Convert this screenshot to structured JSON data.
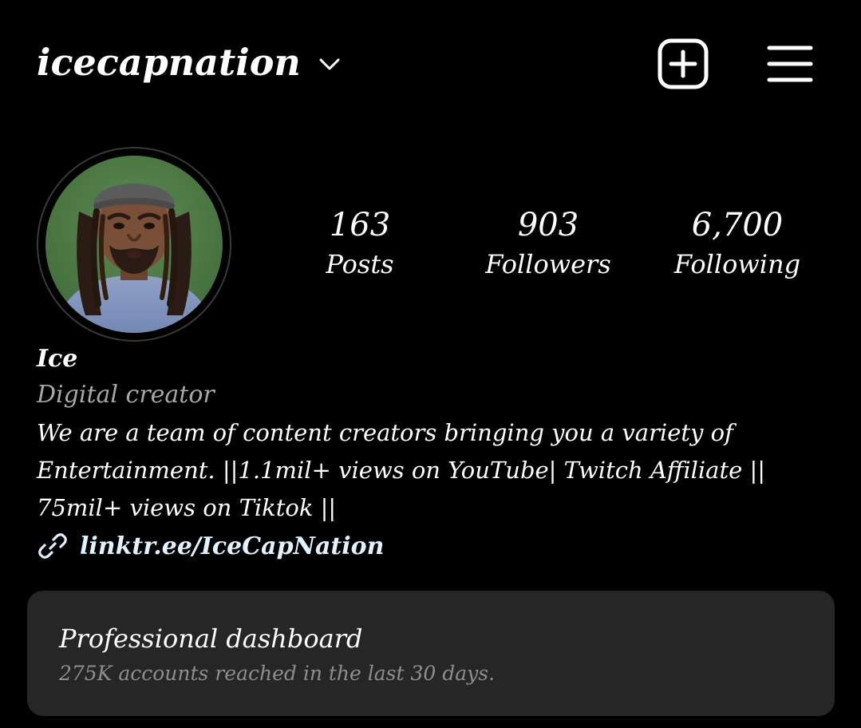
{
  "header": {
    "username": "icecapnation",
    "username_dropdown_icon": "chevron-down-icon",
    "new_post_icon": "plus-square-icon",
    "menu_icon": "hamburger-menu-icon"
  },
  "profile": {
    "avatar_icon": "profile-photo",
    "stats": {
      "posts": {
        "count": "163",
        "label": "Posts"
      },
      "followers": {
        "count": "903",
        "label": "Followers"
      },
      "following": {
        "count": "6,700",
        "label": "Following"
      }
    },
    "display_name": "Ice",
    "category": "Digital creator",
    "bio_lines": [
      "We are a team of content creators bringing you a variety of",
      "Entertainment. ||1.1mil+ views on YouTube| Twitch Affiliate ||",
      "75mil+ views on Tiktok ||"
    ],
    "link": {
      "icon": "link-icon",
      "text": "linktr.ee/IceCapNation"
    }
  },
  "dashboard": {
    "title": "Professional dashboard",
    "subtitle": "275K accounts reached in the last 30 days."
  },
  "colors": {
    "background": "#000000",
    "text": "#ffffff",
    "secondary_text": "#a8a8a8",
    "link_text": "#e0f1ff",
    "card_background": "#262626",
    "card_subtext": "#8e8e8e"
  }
}
